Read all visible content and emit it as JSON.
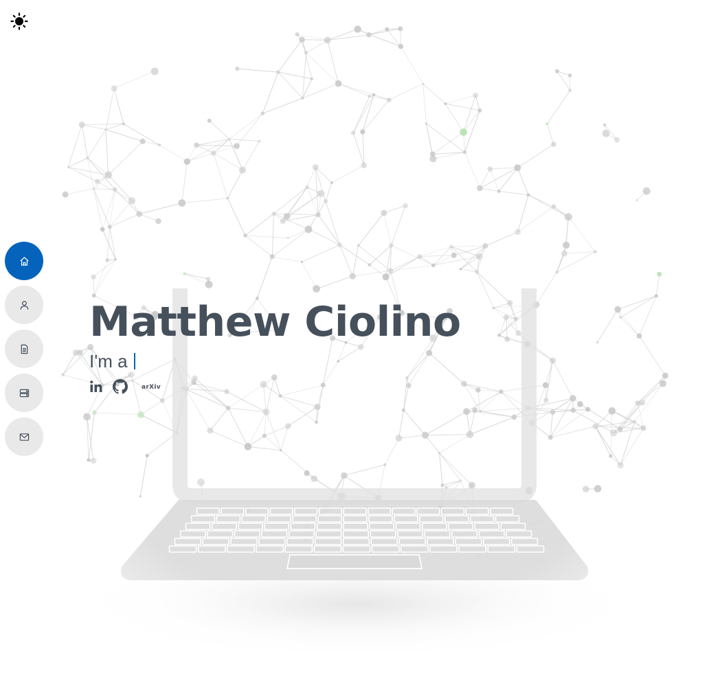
{
  "theme_toggle": {
    "icon": "sun-icon"
  },
  "nav": {
    "items": [
      {
        "name": "home",
        "icon": "home-icon",
        "active": true
      },
      {
        "name": "about",
        "icon": "person-icon",
        "active": false
      },
      {
        "name": "resume",
        "icon": "file-icon",
        "active": false
      },
      {
        "name": "projects",
        "icon": "server-icon",
        "active": false
      },
      {
        "name": "contact",
        "icon": "envelope-icon",
        "active": false
      }
    ]
  },
  "hero": {
    "name": "Matthew Ciolino",
    "typed_prefix": "I'm a"
  },
  "social": {
    "linkedin_icon": "linkedin-icon",
    "github_icon": "github-icon",
    "arxiv_label": "arXiv"
  },
  "colors": {
    "accent": "#0563bb",
    "heading": "#45505b",
    "nav_bg": "#e9e9e9",
    "network_node": "#c8c8c8",
    "network_highlight": "#b6e0b0",
    "laptop": "#d9d9d9"
  }
}
